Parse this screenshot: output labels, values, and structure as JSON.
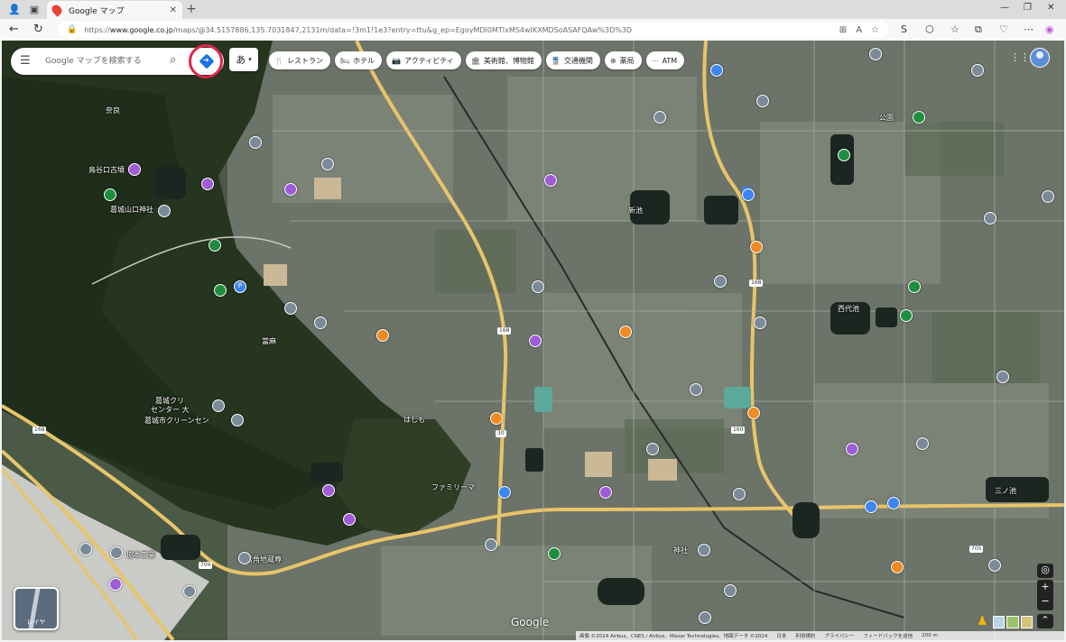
{
  "browser": {
    "tab_title": "Google マップ",
    "url_prefix": "https://",
    "url_host": "www.google.co.jp",
    "url_rest": "/maps/@34.5157886,135.7031847,2131m/data=!3m1!1e3?entry=ttu&g_ep=EgoyMDI0MTIxMS4wIKXMDSoASAFQAw%3D%3D"
  },
  "search": {
    "placeholder": "Google マップを検索する"
  },
  "ime_label": "あ",
  "chips": [
    {
      "icon": "restaurant-icon",
      "label": "レストラン"
    },
    {
      "icon": "hotel-icon",
      "label": "ホテル"
    },
    {
      "icon": "camera-icon",
      "label": "アクティビティ"
    },
    {
      "icon": "museum-icon",
      "label": "美術館、博物館"
    },
    {
      "icon": "train-icon",
      "label": "交通機関"
    },
    {
      "icon": "pharmacy-icon",
      "label": "薬局"
    },
    {
      "icon": "atm-icon",
      "label": "ATM"
    }
  ],
  "map_labels": {
    "shinike": "新池",
    "nishishiroike": "西代池",
    "kuzuhakuri": "葛城クリ",
    "center": "センター 大",
    "clinic": "葛城市クリーンセン",
    "hashimo": "はしも",
    "family": "ファミリーマ",
    "iwakaku": "岩角地蔵尊",
    "kuramoto": "鳥谷口古墳",
    "yamaguchi": "葛城山口神社",
    "taima": "當麻",
    "nanoyama": "奈良",
    "jinja": "神社",
    "koen": "公園",
    "sanzoike": "三ノ池",
    "kogyo": "協本工業"
  },
  "route_numbers": [
    "168",
    "30",
    "705",
    "165",
    "160",
    "704"
  ],
  "layer_label": "レイヤ",
  "google_logo": "Google",
  "footer_items": [
    "画像 ©2024 Airbus、CNES / Airbus、Maxar Technologies、地図データ ©2024",
    "日本",
    "利用規約",
    "プライバシー",
    "フィードバックを送信",
    "200 m"
  ],
  "colors": {
    "accent_blue": "#1a73e8",
    "highlight_ring": "#e0244b",
    "road_yellow": "#e8c46a"
  }
}
